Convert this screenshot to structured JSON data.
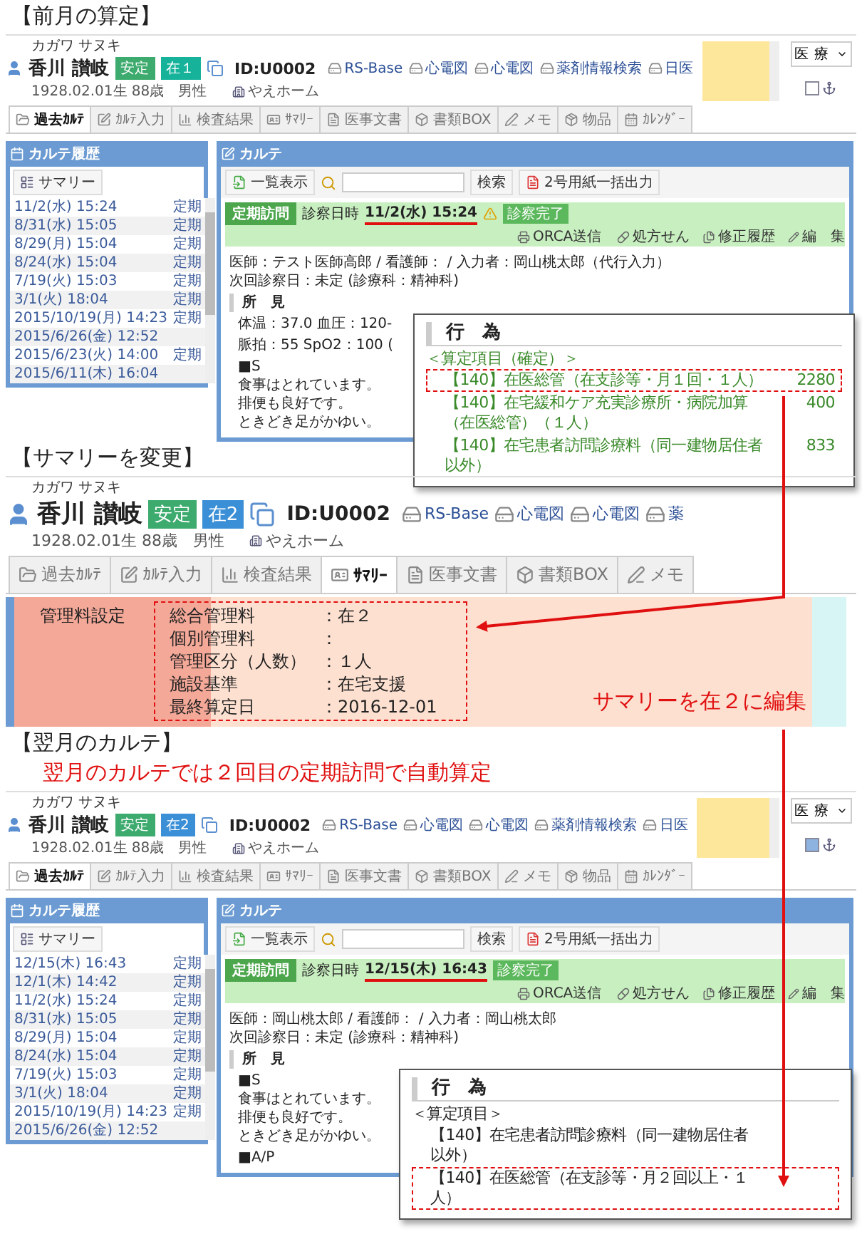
{
  "sections": [
    {
      "title": "【前月の算定】",
      "screen": {
        "kind": "karte",
        "patient": {
          "kana": "カガワ サヌキ",
          "name": "香川 讃岐",
          "badges": [
            {
              "label": "安定",
              "color": "#3daa6e"
            },
            {
              "label": "在１",
              "color": "#16b39a"
            }
          ],
          "id": "ID:U0002",
          "links": [
            "RS-Base",
            "心電図",
            "心電図",
            "薬剤情報検索",
            "日医"
          ],
          "birth": "1928.02.01生 88歳　男性",
          "facility": "やえホーム"
        },
        "notes_area": true,
        "dept": "医療",
        "pin_checked": false,
        "tabs": [
          {
            "label": "過去ｶﾙﾃ",
            "selected": true
          },
          {
            "label": "ｶﾙﾃ入力",
            "selected": false
          },
          {
            "label": "検査結果",
            "selected": false
          },
          {
            "label": "ｻﾏﾘｰ",
            "selected": false
          },
          {
            "label": "医事文書",
            "selected": false
          },
          {
            "label": "書類BOX",
            "selected": false
          },
          {
            "label": "メモ",
            "selected": false
          },
          {
            "label": "物品",
            "selected": false
          },
          {
            "label": "ｶﾚﾝﾀﾞｰ",
            "selected": false
          }
        ],
        "history": {
          "title": "カルテ履歴",
          "summary_button": "サマリー",
          "items": [
            {
              "date": "11/2(水) 15:24",
              "type": "定期"
            },
            {
              "date": "8/31(水) 15:05",
              "type": "定期"
            },
            {
              "date": "8/29(月) 15:04",
              "type": "定期"
            },
            {
              "date": "8/24(水) 15:04",
              "type": "定期"
            },
            {
              "date": "7/19(火) 15:03",
              "type": "定期"
            },
            {
              "date": "3/1(火) 18:04",
              "type": "定期"
            },
            {
              "date": "2015/10/19(月) 14:23",
              "type": "定期"
            },
            {
              "date": "2015/6/26(金) 12:52"
            },
            {
              "date": "2015/6/23(火) 14:00",
              "type": "定期"
            },
            {
              "date": "2015/6/11(木) 16:04"
            }
          ]
        },
        "karte": {
          "title": "カルテ",
          "list_button": "一覧表示",
          "search_button": "検索",
          "export_button": "2号用紙一括出力",
          "visit": {
            "type": "定期訪問",
            "label": "診察日時",
            "datetime": "11/2(水) 15:24",
            "underlined": true,
            "warning": true,
            "status": "診察完了",
            "actions": [
              "ORCA送信",
              "処方せん",
              "修正履歴",
              "編　集"
            ]
          },
          "info": [
            "医師：テスト医師高郎 / 看護師： / 入力者：岡山桃太郎（代行入力）",
            "次回診察日：未定 (診療科：精神科)"
          ],
          "findings_heading": "所　見",
          "blocks": [
            [
              "体温：37.0 血圧：120-"
            ],
            [
              "脈拍：55 SpO2：100 ("
            ],
            [
              "■S",
              "食事はとれています。",
              "排便も良好です。",
              "ときどき足がかゆい。"
            ]
          ]
        }
      },
      "callout": {
        "kind": "confirmed",
        "heading": "行　為",
        "group": "＜算定項目（確定）＞",
        "items": [
          {
            "text": "【140】在医総管（在支診等・月１回・１人）",
            "points": "2280",
            "highlighted": true
          },
          {
            "text": "【140】在宅緩和ケア充実診療所・病院加算（在医総管）（１人）",
            "points": "400",
            "highlighted": false
          },
          {
            "text": "【140】在宅患者訪問診療料（同一建物居住者以外）",
            "points": "833",
            "highlighted": false
          }
        ]
      }
    },
    {
      "title": "【サマリーを変更】",
      "screen": {
        "kind": "summary",
        "patient": {
          "kana": "カガワ サヌキ",
          "name": "香川 讃岐",
          "badges": [
            {
              "label": "安定",
              "color": "#3daa6e"
            },
            {
              "label": "在2",
              "color": "#3b8fd6"
            }
          ],
          "id": "ID:U0002",
          "links": [
            "RS-Base",
            "心電図",
            "心電図",
            "薬"
          ],
          "birth": "1928.02.01生 88歳　男性",
          "facility": "やえホーム"
        },
        "tabs": [
          {
            "label": "過去ｶﾙﾃ",
            "selected": false
          },
          {
            "label": "ｶﾙﾃ入力",
            "selected": false
          },
          {
            "label": "検査結果",
            "selected": false
          },
          {
            "label": "ｻﾏﾘｰ",
            "selected": true
          },
          {
            "label": "医事文書",
            "selected": false
          },
          {
            "label": "書類BOX",
            "selected": false
          },
          {
            "label": "メモ",
            "selected": false
          }
        ],
        "summary": {
          "label": "管理料設定",
          "fields": [
            {
              "label": "総合管理料",
              "value": "：在２"
            },
            {
              "label": "個別管理料",
              "value": "："
            },
            {
              "label": "管理区分（人数）",
              "value": "：１人"
            },
            {
              "label": "施設基準",
              "value": "：在宅支援"
            },
            {
              "label": "最終算定日",
              "value": "：2016-12-01"
            }
          ],
          "note": "サマリーを在２に編集"
        }
      }
    },
    {
      "title": "【翌月のカルテ】",
      "note": "翌月のカルテでは２回目の定期訪問で自動算定",
      "screen": {
        "kind": "karte",
        "patient": {
          "kana": "カガワ サヌキ",
          "name": "香川 讃岐",
          "badges": [
            {
              "label": "安定",
              "color": "#3daa6e"
            },
            {
              "label": "在2",
              "color": "#3b8fd6"
            }
          ],
          "id": "ID:U0002",
          "links": [
            "RS-Base",
            "心電図",
            "心電図",
            "薬剤情報検索",
            "日医"
          ],
          "birth": "1928.02.01生 88歳　男性",
          "facility": "やえホーム"
        },
        "notes_area": true,
        "dept": "医療",
        "pin_checked": true,
        "tabs": [
          {
            "label": "過去ｶﾙﾃ",
            "selected": true
          },
          {
            "label": "ｶﾙﾃ入力",
            "selected": false
          },
          {
            "label": "検査結果",
            "selected": false
          },
          {
            "label": "ｻﾏﾘｰ",
            "selected": false
          },
          {
            "label": "医事文書",
            "selected": false
          },
          {
            "label": "書類BOX",
            "selected": false
          },
          {
            "label": "メモ",
            "selected": false
          },
          {
            "label": "物品",
            "selected": false
          },
          {
            "label": "ｶﾚﾝﾀﾞｰ",
            "selected": false
          }
        ],
        "history": {
          "title": "カルテ履歴",
          "summary_button": "サマリー",
          "items": [
            {
              "date": "12/15(木) 16:43",
              "type": "定期"
            },
            {
              "date": "12/1(木) 14:42",
              "type": "定期"
            },
            {
              "date": "11/2(水) 15:24",
              "type": "定期"
            },
            {
              "date": "8/31(水) 15:05",
              "type": "定期"
            },
            {
              "date": "8/29(月) 15:04",
              "type": "定期"
            },
            {
              "date": "8/24(水) 15:04",
              "type": "定期"
            },
            {
              "date": "7/19(火) 15:03",
              "type": "定期"
            },
            {
              "date": "3/1(火) 18:04",
              "type": "定期"
            },
            {
              "date": "2015/10/19(月) 14:23",
              "type": "定期"
            },
            {
              "date": "2015/6/26(金) 12:52"
            }
          ]
        },
        "karte": {
          "title": "カルテ",
          "list_button": "一覧表示",
          "search_button": "検索",
          "export_button": "2号用紙一括出力",
          "visit": {
            "type": "定期訪問",
            "label": "診察日時",
            "datetime": "12/15(木) 16:43",
            "underlined": true,
            "warning": false,
            "status": "診察完了",
            "actions": [
              "ORCA送信",
              "処方せん",
              "修正履歴",
              "編　集"
            ]
          },
          "info": [
            "医師：岡山桃太郎 / 看護師： / 入力者：岡山桃太郎",
            "次回診察日：未定 (診療科：精神科)"
          ],
          "findings_heading": "所　見",
          "blocks": [
            [
              "■S",
              "食事はとれています。",
              "排便も良好です。",
              "ときどき足がかゆい。"
            ],
            [
              "■A/P"
            ]
          ]
        }
      },
      "callout": {
        "kind": "pending",
        "heading": "行　為",
        "group": "＜算定項目＞",
        "items": [
          {
            "text": "【140】在宅患者訪問診療料（同一建物居住者以外）",
            "highlighted": false
          },
          {
            "text": "【140】在医総管（在支診等・月２回以上・１人）",
            "highlighted": true
          }
        ]
      }
    }
  ]
}
